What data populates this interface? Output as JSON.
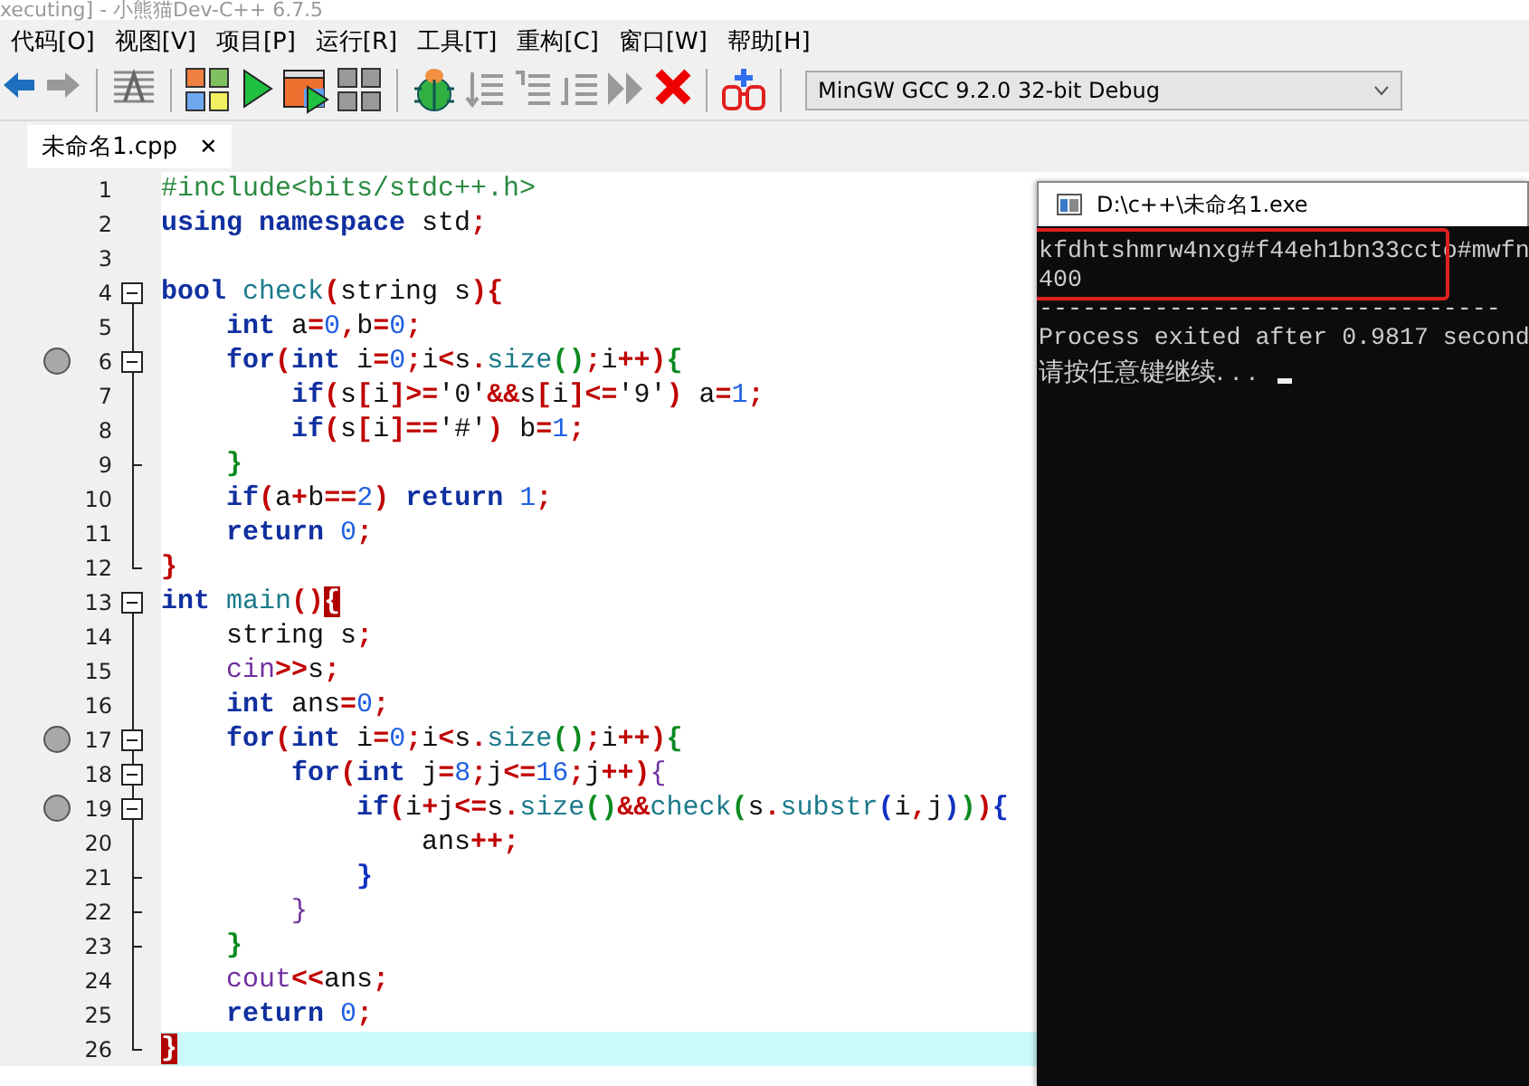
{
  "window": {
    "title": "xecuting] - 小熊猫Dev-C++ 6.7.5"
  },
  "menu": [
    "代码[O]",
    "视图[V]",
    "项目[P]",
    "运行[R]",
    "工具[T]",
    "重构[C]",
    "窗口[W]",
    "帮助[H]"
  ],
  "compiler": {
    "value": "MinGW GCC 9.2.0 32-bit Debug"
  },
  "tabs": [
    {
      "label": "未命名1.cpp",
      "close": "✕",
      "selected": true
    }
  ],
  "editor": {
    "lines": [
      {
        "number": "1",
        "fold_toggle": false,
        "fold_end": false,
        "breakpoint": false,
        "current": false,
        "tokens": [
          {
            "kind": "directive",
            "text": "#include<bits/stdc++.h>"
          }
        ]
      },
      {
        "number": "2",
        "fold_toggle": false,
        "fold_end": false,
        "breakpoint": false,
        "current": false,
        "tokens": [
          {
            "kind": "keyword",
            "text": "using"
          },
          {
            "kind": "keyword",
            "text": " namespace"
          },
          {
            "kind": "plain",
            "text": " std"
          },
          {
            "kind": "operator",
            "text": ";"
          }
        ]
      },
      {
        "number": "3",
        "fold_toggle": false,
        "fold_end": false,
        "breakpoint": false,
        "current": false
      },
      {
        "number": "4",
        "fold_toggle": true,
        "fold_end": false,
        "breakpoint": false,
        "current": false,
        "tokens": [
          {
            "kind": "keyword",
            "text": "bool"
          },
          {
            "kind": "function",
            "text": " check"
          },
          {
            "kind": "outer",
            "text": "("
          },
          {
            "kind": "plain",
            "text": "string s"
          },
          {
            "kind": "outer",
            "text": ")"
          },
          {
            "kind": "outer",
            "text": "{"
          }
        ]
      },
      {
        "number": "5",
        "fold_toggle": false,
        "fold_end": false,
        "breakpoint": false,
        "current": false,
        "tokens": [
          {
            "kind": "keyword",
            "text": "    int"
          },
          {
            "kind": "plain",
            "text": " a"
          },
          {
            "kind": "operator",
            "text": "="
          },
          {
            "kind": "number",
            "text": "0"
          },
          {
            "kind": "operator",
            "text": ","
          },
          {
            "kind": "plain",
            "text": "b"
          },
          {
            "kind": "operator",
            "text": "="
          },
          {
            "kind": "number",
            "text": "0"
          },
          {
            "kind": "operator",
            "text": ";"
          }
        ]
      },
      {
        "number": "6",
        "fold_toggle": true,
        "fold_end": false,
        "breakpoint": true,
        "current": false,
        "tokens": [
          {
            "kind": "keyword",
            "text": "    for"
          },
          {
            "kind": "outer",
            "text": "("
          },
          {
            "kind": "keyword",
            "text": "int"
          },
          {
            "kind": "plain",
            "text": " i"
          },
          {
            "kind": "operator",
            "text": "="
          },
          {
            "kind": "number",
            "text": "0"
          },
          {
            "kind": "operator",
            "text": ";"
          },
          {
            "kind": "plain",
            "text": "i"
          },
          {
            "kind": "operator",
            "text": "<"
          },
          {
            "kind": "plain",
            "text": "s"
          },
          {
            "kind": "operator",
            "text": "."
          },
          {
            "kind": "function",
            "text": "size"
          },
          {
            "kind": "inner",
            "text": "()"
          },
          {
            "kind": "operator",
            "text": ";"
          },
          {
            "kind": "plain",
            "text": "i"
          },
          {
            "kind": "operator",
            "text": "++"
          },
          {
            "kind": "outer",
            "text": ")"
          },
          {
            "kind": "inner",
            "text": "{"
          }
        ]
      },
      {
        "number": "7",
        "fold_toggle": false,
        "fold_end": false,
        "breakpoint": false,
        "current": false,
        "tokens": [
          {
            "kind": "keyword",
            "text": "        if"
          },
          {
            "kind": "outer",
            "text": "("
          },
          {
            "kind": "plain",
            "text": "s"
          },
          {
            "kind": "outer",
            "text": "["
          },
          {
            "kind": "plain",
            "text": "i"
          },
          {
            "kind": "outer",
            "text": "]"
          },
          {
            "kind": "operator",
            "text": ">="
          },
          {
            "kind": "plain",
            "text": "'0'"
          },
          {
            "kind": "operator",
            "text": "&&"
          },
          {
            "kind": "plain",
            "text": "s"
          },
          {
            "kind": "outer",
            "text": "["
          },
          {
            "kind": "plain",
            "text": "i"
          },
          {
            "kind": "outer",
            "text": "]"
          },
          {
            "kind": "operator",
            "text": "<="
          },
          {
            "kind": "plain",
            "text": "'9'"
          },
          {
            "kind": "outer",
            "text": ")"
          },
          {
            "kind": "plain",
            "text": " a"
          },
          {
            "kind": "operator",
            "text": "="
          },
          {
            "kind": "number",
            "text": "1"
          },
          {
            "kind": "operator",
            "text": ";"
          }
        ]
      },
      {
        "number": "8",
        "fold_toggle": false,
        "fold_end": false,
        "breakpoint": false,
        "current": false,
        "tokens": [
          {
            "kind": "keyword",
            "text": "        if"
          },
          {
            "kind": "outer",
            "text": "("
          },
          {
            "kind": "plain",
            "text": "s"
          },
          {
            "kind": "outer",
            "text": "["
          },
          {
            "kind": "plain",
            "text": "i"
          },
          {
            "kind": "outer",
            "text": "]"
          },
          {
            "kind": "operator",
            "text": "=="
          },
          {
            "kind": "plain",
            "text": "'#'"
          },
          {
            "kind": "outer",
            "text": ")"
          },
          {
            "kind": "plain",
            "text": " b"
          },
          {
            "kind": "operator",
            "text": "="
          },
          {
            "kind": "number",
            "text": "1"
          },
          {
            "kind": "operator",
            "text": ";"
          }
        ]
      },
      {
        "number": "9",
        "fold_toggle": false,
        "fold_end": true,
        "breakpoint": false,
        "current": false,
        "tokens": [
          {
            "kind": "inner",
            "text": "    }"
          }
        ]
      },
      {
        "number": "10",
        "fold_toggle": false,
        "fold_end": false,
        "breakpoint": false,
        "current": false,
        "tokens": [
          {
            "kind": "keyword",
            "text": "    if"
          },
          {
            "kind": "outer",
            "text": "("
          },
          {
            "kind": "plain",
            "text": "a"
          },
          {
            "kind": "operator",
            "text": "+"
          },
          {
            "kind": "plain",
            "text": "b"
          },
          {
            "kind": "operator",
            "text": "=="
          },
          {
            "kind": "number",
            "text": "2"
          },
          {
            "kind": "outer",
            "text": ")"
          },
          {
            "kind": "keyword",
            "text": " return"
          },
          {
            "kind": "number",
            "text": " 1"
          },
          {
            "kind": "operator",
            "text": ";"
          }
        ]
      },
      {
        "number": "11",
        "fold_toggle": false,
        "fold_end": false,
        "breakpoint": false,
        "current": false,
        "tokens": [
          {
            "kind": "keyword",
            "text": "    return"
          },
          {
            "kind": "number",
            "text": " 0"
          },
          {
            "kind": "operator",
            "text": ";"
          }
        ]
      },
      {
        "number": "12",
        "fold_toggle": false,
        "fold_end": true,
        "breakpoint": false,
        "current": false,
        "tokens": [
          {
            "kind": "outer",
            "text": "}"
          }
        ]
      },
      {
        "number": "13",
        "fold_toggle": true,
        "fold_end": false,
        "breakpoint": false,
        "current": false,
        "tokens": [
          {
            "kind": "keyword",
            "text": "int"
          },
          {
            "kind": "function",
            "text": " main"
          },
          {
            "kind": "outer",
            "text": "()"
          },
          {
            "kind": "matched",
            "text": "{"
          }
        ]
      },
      {
        "number": "14",
        "fold_toggle": false,
        "fold_end": false,
        "breakpoint": false,
        "current": false,
        "tokens": [
          {
            "kind": "plain",
            "text": "    string s"
          },
          {
            "kind": "operator",
            "text": ";"
          }
        ]
      },
      {
        "number": "15",
        "fold_toggle": false,
        "fold_end": false,
        "breakpoint": false,
        "current": false,
        "tokens": [
          {
            "kind": "deepest",
            "text": "    cin"
          },
          {
            "kind": "operator",
            "text": ">>"
          },
          {
            "kind": "plain",
            "text": "s"
          },
          {
            "kind": "operator",
            "text": ";"
          }
        ]
      },
      {
        "number": "16",
        "fold_toggle": false,
        "fold_end": false,
        "breakpoint": false,
        "current": false,
        "tokens": [
          {
            "kind": "keyword",
            "text": "    int"
          },
          {
            "kind": "plain",
            "text": " ans"
          },
          {
            "kind": "operator",
            "text": "="
          },
          {
            "kind": "number",
            "text": "0"
          },
          {
            "kind": "operator",
            "text": ";"
          }
        ]
      },
      {
        "number": "17",
        "fold_toggle": true,
        "fold_end": false,
        "breakpoint": true,
        "current": false,
        "tokens": [
          {
            "kind": "keyword",
            "text": "    for"
          },
          {
            "kind": "outer",
            "text": "("
          },
          {
            "kind": "keyword",
            "text": "int"
          },
          {
            "kind": "plain",
            "text": " i"
          },
          {
            "kind": "operator",
            "text": "="
          },
          {
            "kind": "number",
            "text": "0"
          },
          {
            "kind": "operator",
            "text": ";"
          },
          {
            "kind": "plain",
            "text": "i"
          },
          {
            "kind": "operator",
            "text": "<"
          },
          {
            "kind": "plain",
            "text": "s"
          },
          {
            "kind": "operator",
            "text": "."
          },
          {
            "kind": "function",
            "text": "size"
          },
          {
            "kind": "inner",
            "text": "()"
          },
          {
            "kind": "operator",
            "text": ";"
          },
          {
            "kind": "plain",
            "text": "i"
          },
          {
            "kind": "operator",
            "text": "++"
          },
          {
            "kind": "outer",
            "text": ")"
          },
          {
            "kind": "inner",
            "text": "{"
          }
        ]
      },
      {
        "number": "18",
        "fold_toggle": true,
        "fold_end": false,
        "breakpoint": false,
        "current": false,
        "tokens": [
          {
            "kind": "keyword",
            "text": "        for"
          },
          {
            "kind": "outer",
            "text": "("
          },
          {
            "kind": "keyword",
            "text": "int"
          },
          {
            "kind": "plain",
            "text": " j"
          },
          {
            "kind": "operator",
            "text": "="
          },
          {
            "kind": "number",
            "text": "8"
          },
          {
            "kind": "operator",
            "text": ";"
          },
          {
            "kind": "plain",
            "text": "j"
          },
          {
            "kind": "operator",
            "text": "<="
          },
          {
            "kind": "number",
            "text": "16"
          },
          {
            "kind": "operator",
            "text": ";"
          },
          {
            "kind": "plain",
            "text": "j"
          },
          {
            "kind": "operator",
            "text": "++"
          },
          {
            "kind": "outer",
            "text": ")"
          },
          {
            "kind": "deepest",
            "text": "{"
          }
        ]
      },
      {
        "number": "19",
        "fold_toggle": true,
        "fold_end": false,
        "breakpoint": true,
        "current": false,
        "tokens": [
          {
            "kind": "keyword",
            "text": "            if"
          },
          {
            "kind": "outer",
            "text": "("
          },
          {
            "kind": "plain",
            "text": "i"
          },
          {
            "kind": "operator",
            "text": "+"
          },
          {
            "kind": "plain",
            "text": "j"
          },
          {
            "kind": "operator",
            "text": "<="
          },
          {
            "kind": "plain",
            "text": "s"
          },
          {
            "kind": "operator",
            "text": "."
          },
          {
            "kind": "function",
            "text": "size"
          },
          {
            "kind": "inner",
            "text": "()"
          },
          {
            "kind": "operator",
            "text": "&&"
          },
          {
            "kind": "function",
            "text": "check"
          },
          {
            "kind": "inner",
            "text": "("
          },
          {
            "kind": "plain",
            "text": "s"
          },
          {
            "kind": "operator",
            "text": "."
          },
          {
            "kind": "function",
            "text": "substr"
          },
          {
            "kind": "deep",
            "text": "("
          },
          {
            "kind": "plain",
            "text": "i"
          },
          {
            "kind": "operator",
            "text": ","
          },
          {
            "kind": "plain",
            "text": "j"
          },
          {
            "kind": "deep",
            "text": ")"
          },
          {
            "kind": "inner",
            "text": ")"
          },
          {
            "kind": "outer",
            "text": ")"
          },
          {
            "kind": "deep",
            "text": "{"
          }
        ]
      },
      {
        "number": "20",
        "fold_toggle": false,
        "fold_end": false,
        "breakpoint": false,
        "current": false,
        "tokens": [
          {
            "kind": "plain",
            "text": "                ans"
          },
          {
            "kind": "operator",
            "text": "++;"
          }
        ]
      },
      {
        "number": "21",
        "fold_toggle": false,
        "fold_end": true,
        "breakpoint": false,
        "current": false,
        "tokens": [
          {
            "kind": "deep",
            "text": "            }"
          }
        ]
      },
      {
        "number": "22",
        "fold_toggle": false,
        "fold_end": true,
        "breakpoint": false,
        "current": false,
        "tokens": [
          {
            "kind": "deepest",
            "text": "        }"
          }
        ]
      },
      {
        "number": "23",
        "fold_toggle": false,
        "fold_end": true,
        "breakpoint": false,
        "current": false,
        "tokens": [
          {
            "kind": "inner",
            "text": "    }"
          }
        ]
      },
      {
        "number": "24",
        "fold_toggle": false,
        "fold_end": false,
        "breakpoint": false,
        "current": false,
        "tokens": [
          {
            "kind": "deepest",
            "text": "    cout"
          },
          {
            "kind": "operator",
            "text": "<<"
          },
          {
            "kind": "plain",
            "text": "ans"
          },
          {
            "kind": "operator",
            "text": ";"
          }
        ]
      },
      {
        "number": "25",
        "fold_toggle": false,
        "fold_end": false,
        "breakpoint": false,
        "current": false,
        "tokens": [
          {
            "kind": "keyword",
            "text": "    return"
          },
          {
            "kind": "number",
            "text": " 0"
          },
          {
            "kind": "operator",
            "text": ";"
          }
        ]
      },
      {
        "number": "26",
        "fold_toggle": false,
        "fold_end": true,
        "breakpoint": false,
        "current": true,
        "tokens": [
          {
            "kind": "matched",
            "text": "}"
          }
        ]
      }
    ]
  },
  "console": {
    "title": "D:\\c++\\未命名1.exe",
    "highlight_box": true,
    "cursor": true,
    "output": [
      "kfdhtshmrw4nxg#f44eh1bn33ccto#mwfn",
      "400",
      "--------------------------------",
      "Process exited after 0.9817 second",
      "请按任意键继续. . ."
    ]
  }
}
